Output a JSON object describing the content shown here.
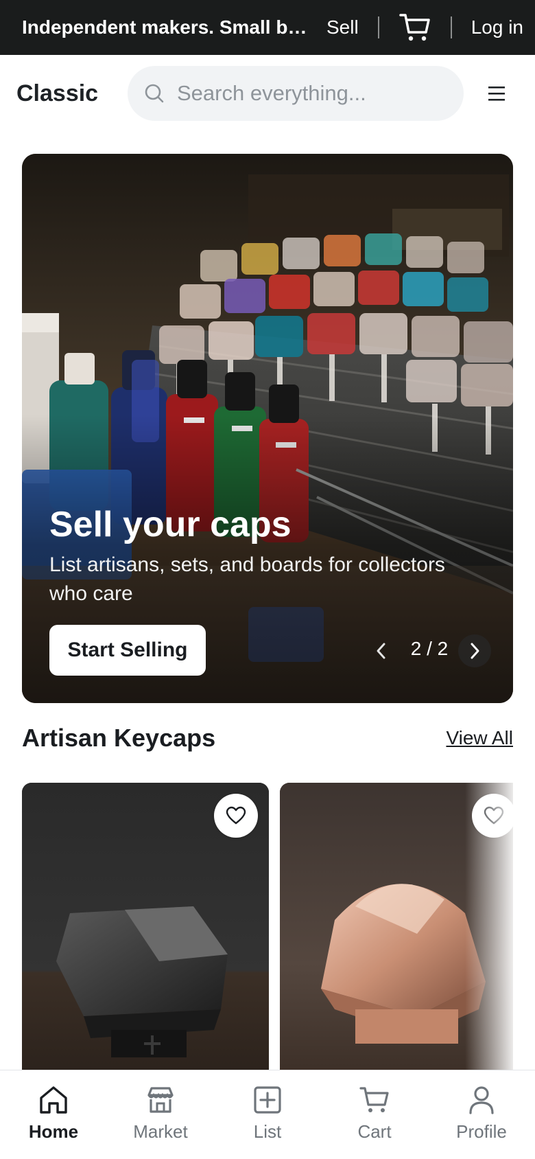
{
  "topbar": {
    "tagline": "Independent makers. Small batches.",
    "sell_label": "Sell",
    "cart_icon": "cart-icon",
    "login_label": "Log in"
  },
  "header": {
    "brand": "Classic",
    "search_placeholder": "Search everything...",
    "menu_icon": "hamburger-menu-icon"
  },
  "hero": {
    "title": "Sell your caps",
    "subtitle": "List artisans, sets, and boards for collectors who care",
    "cta_label": "Start Selling",
    "counter": "2 / 2"
  },
  "section": {
    "title": "Artisan Keycaps",
    "view_all_label": "View All"
  },
  "products": [
    {
      "image": "black-metal-keycap",
      "favorite_icon": "heart-icon"
    },
    {
      "image": "copper-keycap",
      "favorite_icon": "heart-icon"
    }
  ],
  "bottom_nav": {
    "active": "Home",
    "items": [
      {
        "label": "Home",
        "icon": "home-icon"
      },
      {
        "label": "Market",
        "icon": "store-icon"
      },
      {
        "label": "List",
        "icon": "plus-square-icon"
      },
      {
        "label": "Cart",
        "icon": "cart-icon"
      },
      {
        "label": "Profile",
        "icon": "user-icon"
      }
    ]
  },
  "colors": {
    "topbar_bg": "#1a1c1c",
    "search_bg": "#f1f3f5",
    "text_primary": "#1a1d21",
    "text_muted": "#6f757b"
  }
}
